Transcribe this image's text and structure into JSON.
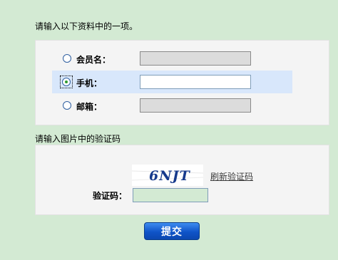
{
  "form": {
    "instruction": "请输入以下资料中的一项。",
    "options": [
      {
        "label": "会员名：",
        "checked": false,
        "value": ""
      },
      {
        "label": "手机：",
        "checked": true,
        "value": ""
      },
      {
        "label": "邮箱：",
        "checked": false,
        "value": ""
      }
    ]
  },
  "captcha": {
    "instruction": "请输入图片中的验证码",
    "image_text": "6NJT",
    "refresh_label": "刷新验证码",
    "code_label": "验证码：",
    "code_value": ""
  },
  "submit_label": "提交",
  "colors": {
    "page_bg": "#d3ead3",
    "panel_bg": "#f4f4f4",
    "selected_row_bg": "#d8e7fb",
    "button": "#0f54c8"
  }
}
